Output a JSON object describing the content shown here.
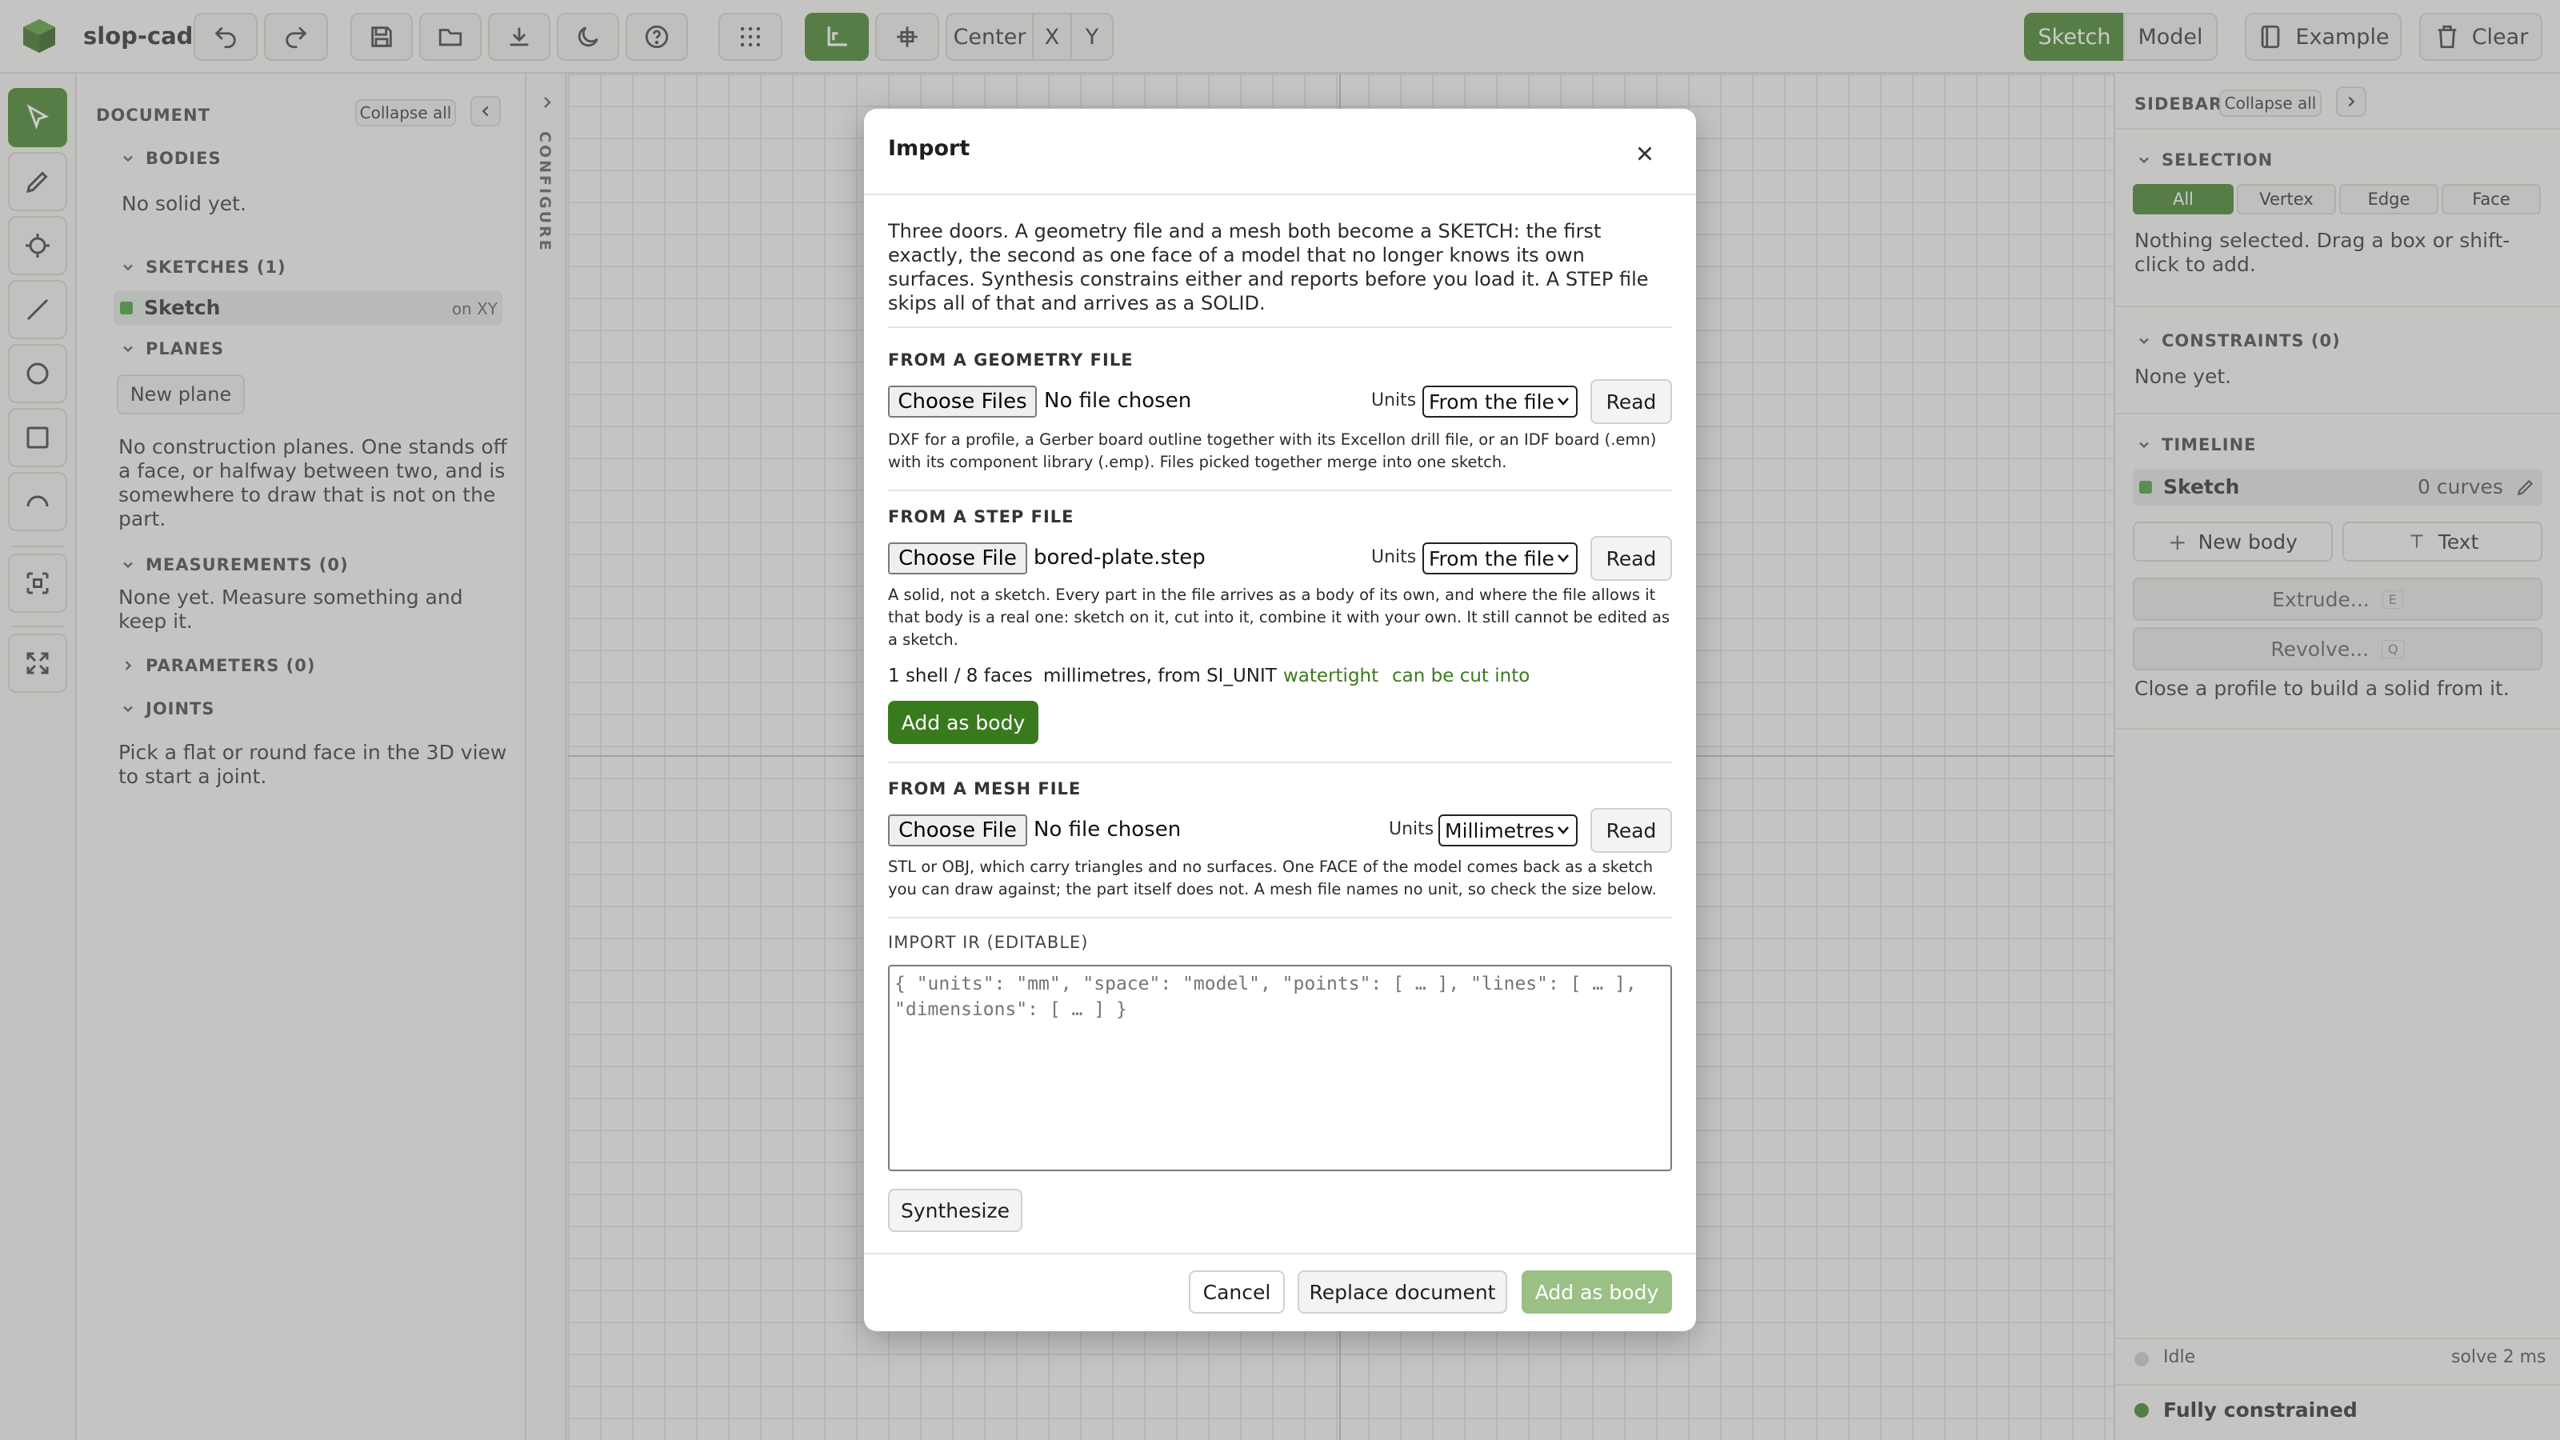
{
  "app": {
    "name": "slop-cad"
  },
  "toolbar": {
    "center_label": "Center",
    "x_label": "X",
    "y_label": "Y",
    "sketch_label": "Sketch",
    "model_label": "Model",
    "example_label": "Example",
    "clear_label": "Clear"
  },
  "left_panel": {
    "title": "DOCUMENT",
    "collapse_all": "Collapse all",
    "bodies": {
      "title": "BODIES",
      "empty": "No solid yet."
    },
    "sketches": {
      "title": "SKETCHES (1)",
      "items": [
        {
          "label": "Sketch",
          "plane": "on XY"
        }
      ]
    },
    "planes": {
      "title": "PLANES",
      "new_plane": "New plane",
      "text": "No construction planes. One stands off a face, or halfway between two, and is somewhere to draw that is not on the part."
    },
    "measurements": {
      "title": "MEASUREMENTS (0)",
      "text": "None yet. Measure something and keep it."
    },
    "parameters": {
      "title": "PARAMETERS (0)"
    },
    "joints": {
      "title": "JOINTS",
      "text": "Pick a flat or round face in the 3D view to start a joint."
    }
  },
  "configure": {
    "label": "CONFIGURE"
  },
  "sidebar": {
    "title": "SIDEBAR",
    "collapse_all": "Collapse all",
    "selection": {
      "title": "SELECTION",
      "modes": [
        "All",
        "Vertex",
        "Edge",
        "Face"
      ],
      "active": "All",
      "text": "Nothing selected. Drag a box or shift-click to add."
    },
    "constraints": {
      "title": "CONSTRAINTS (0)",
      "text": "None yet."
    },
    "timeline": {
      "title": "TIMELINE",
      "item": {
        "label": "Sketch",
        "meta": "0 curves"
      },
      "new_body": "New body",
      "text_btn": "Text",
      "extrude": "Extrude...",
      "extrude_key": "E",
      "revolve": "Revolve...",
      "revolve_key": "Q",
      "hint": "Close a profile to build a solid from it."
    },
    "status": {
      "state": "Idle",
      "solve": "solve 2 ms",
      "constraint_state": "Fully constrained"
    }
  },
  "modal": {
    "title": "Import",
    "intro": "Three doors. A geometry file and a mesh both become a SKETCH: the first exactly, the second as one face of a model that no longer knows its own surfaces. Synthesis constrains either and reports before you load it. A STEP file skips all of that and arrives as a SOLID.",
    "geometry": {
      "title": "FROM A GEOMETRY FILE",
      "choose": "Choose Files",
      "file": "No file chosen",
      "units_label": "Units",
      "units": "From the file",
      "read": "Read",
      "desc": "DXF for a profile, a Gerber board outline together with its Excellon drill file, or an IDF board (.emn) with its component library (.emp). Files picked together merge into one sketch."
    },
    "step": {
      "title": "FROM A STEP FILE",
      "choose": "Choose File",
      "file": "bored-plate.step",
      "units_label": "Units",
      "units": "From the file",
      "read": "Read",
      "desc": "A solid, not a sketch. Every part in the file arrives as a body of its own, and where the file allows it that body is a real one: sketch on it, cut into it, combine it with your own. It still cannot be edited as a sketch.",
      "stats": "1 shell / 8 faces",
      "units_info": "millimetres, from SI_UNIT",
      "badge_watertight": "watertight",
      "badge_cut": "can be cut into",
      "add_body": "Add as body"
    },
    "mesh": {
      "title": "FROM A MESH FILE",
      "choose": "Choose File",
      "file": "No file chosen",
      "units_label": "Units",
      "units": "Millimetres",
      "read": "Read",
      "desc": "STL or OBJ, which carry triangles and no surfaces. One FACE of the model comes back as a sketch you can draw against; the part itself does not. A mesh file names no unit, so check the size below."
    },
    "ir": {
      "title": "IMPORT IR (EDITABLE)",
      "placeholder": "{ \"units\": \"mm\", \"space\": \"model\", \"points\": [ … ], \"lines\": [ … ], \"dimensions\": [ … ] }"
    },
    "synthesize": "Synthesize",
    "cancel": "Cancel",
    "replace": "Replace document",
    "add_body": "Add as body"
  },
  "colors": {
    "accent": "#3a7a1e",
    "overlay": "rgba(128,128,128,0.42)"
  }
}
